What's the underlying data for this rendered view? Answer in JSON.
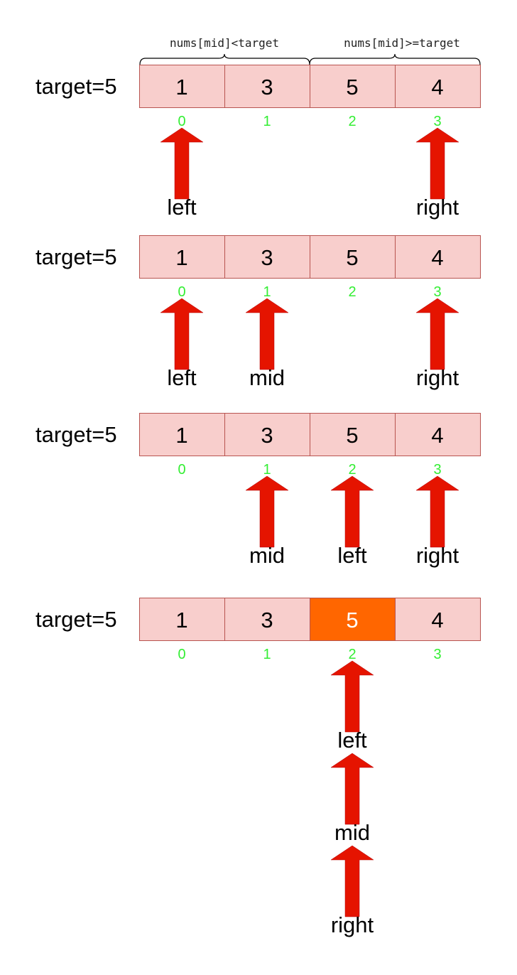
{
  "conditions": {
    "left": "nums[mid]<target",
    "right": "nums[mid]>=target"
  },
  "target_label": "target=5",
  "array": [
    1,
    3,
    5,
    4
  ],
  "indices": [
    "0",
    "1",
    "2",
    "3"
  ],
  "colors": {
    "cell_fill": "#f8cecc",
    "cell_border": "#b85450",
    "highlight_fill": "#ff6600",
    "arrow": "#e51400",
    "index_text": "#33ee33"
  },
  "steps": [
    {
      "highlight": null,
      "pointers": [
        {
          "index": 0,
          "labels": [
            "left"
          ]
        },
        {
          "index": 3,
          "labels": [
            "right"
          ]
        }
      ]
    },
    {
      "highlight": null,
      "pointers": [
        {
          "index": 0,
          "labels": [
            "left"
          ]
        },
        {
          "index": 1,
          "labels": [
            "mid"
          ]
        },
        {
          "index": 3,
          "labels": [
            "right"
          ]
        }
      ]
    },
    {
      "highlight": null,
      "pointers": [
        {
          "index": 1,
          "labels": [
            "mid"
          ]
        },
        {
          "index": 2,
          "labels": [
            "left"
          ]
        },
        {
          "index": 3,
          "labels": [
            "right"
          ]
        }
      ]
    },
    {
      "highlight": 2,
      "pointers": [
        {
          "index": 2,
          "labels": [
            "left",
            "mid",
            "right"
          ]
        }
      ]
    }
  ]
}
